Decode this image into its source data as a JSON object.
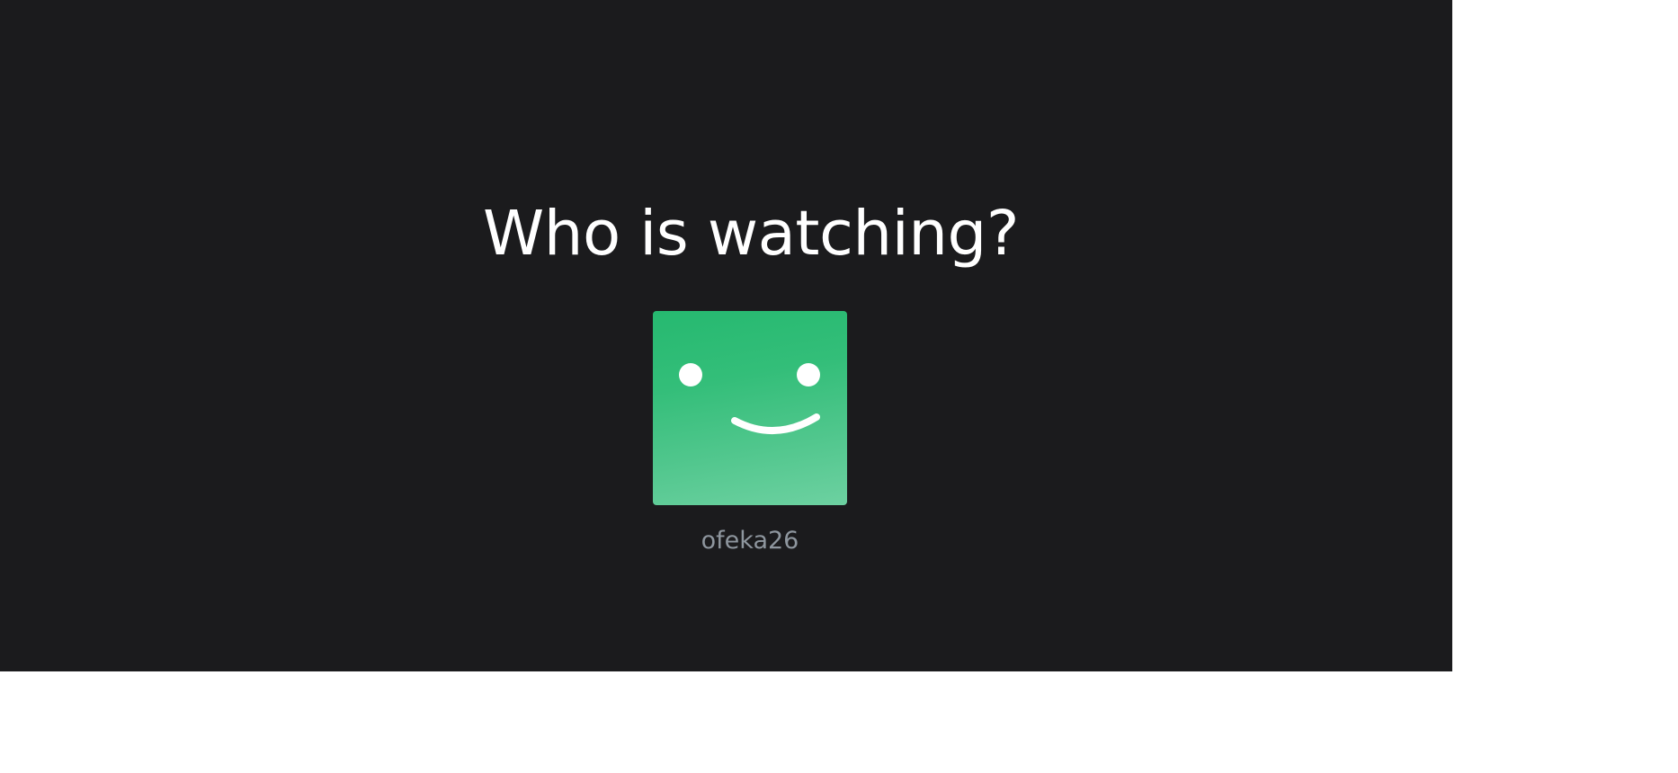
{
  "page": {
    "heading": "Who is watching?",
    "background_color": "#1b1b1d"
  },
  "profiles": [
    {
      "name": "ofeka26",
      "avatar_icon": "smiley-face-icon",
      "avatar_color": "#26b970"
    }
  ]
}
